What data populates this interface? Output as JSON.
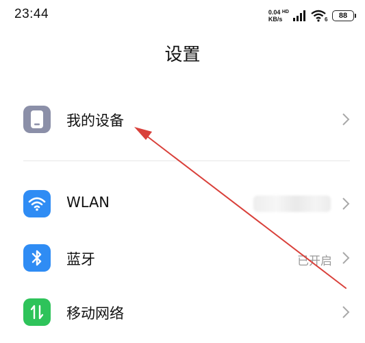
{
  "status_bar": {
    "time": "23:44",
    "net_speed_value": "0.04",
    "net_speed_unit": "KB/s",
    "hd_label": "HD",
    "wifi_badge": "6",
    "battery": "88"
  },
  "header": {
    "title": "设置"
  },
  "items": [
    {
      "label": "我的设备",
      "value": "",
      "icon": "phone-icon",
      "icon_color": "#8b8fa8"
    },
    {
      "label": "WLAN",
      "value": "",
      "icon": "wifi-icon",
      "icon_color": "#2f8cf4"
    },
    {
      "label": "蓝牙",
      "value": "已开启",
      "icon": "bluetooth-icon",
      "icon_color": "#2f8cf4"
    },
    {
      "label": "移动网络",
      "value": "",
      "icon": "mobile-network-icon",
      "icon_color": "#2ec35a"
    }
  ],
  "annotation": {
    "type": "red-arrow",
    "color": "#d9403a",
    "points_to": "我的设备"
  }
}
